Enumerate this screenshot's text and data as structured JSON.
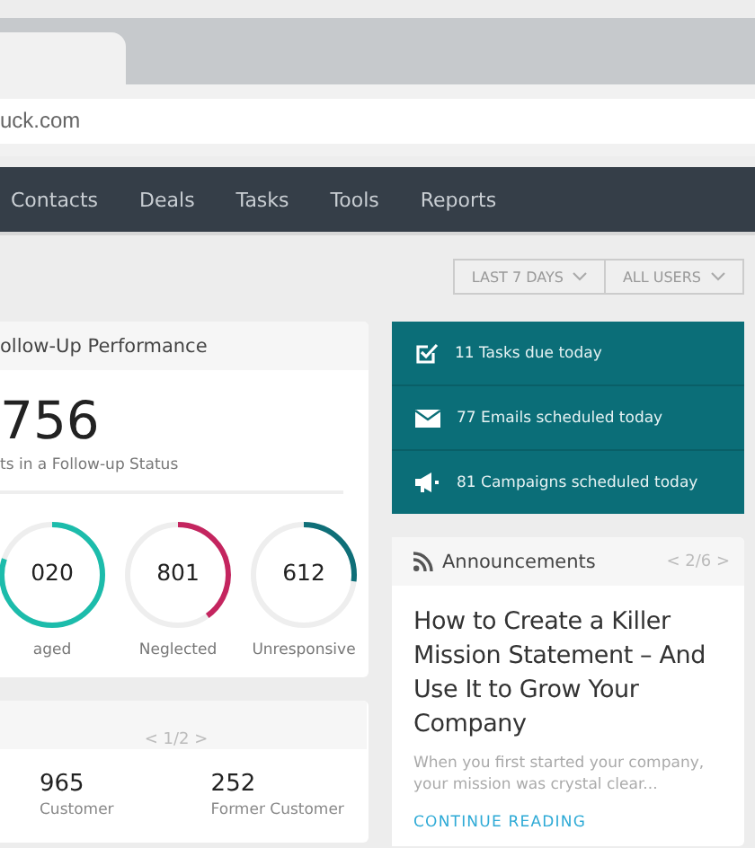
{
  "browser": {
    "address": "uck.com"
  },
  "nav": [
    {
      "label": "Contacts",
      "selected": false
    },
    {
      "label": "Deals",
      "selected": false
    },
    {
      "label": "Tasks",
      "selected": false
    },
    {
      "label": "Tools",
      "selected": false
    },
    {
      "label": "Reports",
      "selected": false
    }
  ],
  "filters": [
    {
      "label": "LAST 7 DAYS"
    },
    {
      "label": "ALL USERS"
    }
  ],
  "follow_up": {
    "title": "ollow-Up Performance",
    "total": "756",
    "subtitle": "ts in a Follow-up Status",
    "rings": [
      {
        "value": "020",
        "label": "aged",
        "level": 0.8,
        "color": "#1cbcab"
      },
      {
        "value": "801",
        "label": "Neglected",
        "level": 0.4,
        "color": "#c4255f"
      },
      {
        "value": "612",
        "label": "Unresponsive",
        "level": 0.27,
        "color": "#0f6f78"
      }
    ]
  },
  "today": [
    {
      "kind": "tasks",
      "text": "11 Tasks due today"
    },
    {
      "kind": "emails",
      "text": "77 Emails scheduled today"
    },
    {
      "kind": "campaigns",
      "text": "81 Campaigns scheduled today"
    }
  ],
  "announcements": {
    "title": "Announcements",
    "pager": "< 2/6 >",
    "headline": "How to Create a Killer Mission Statement – And Use It to Grow Your Company",
    "excerpt": "When you first started your company, your mission was crystal clear...",
    "link": "CONTINUE READING"
  },
  "contacts_card": {
    "pager": "< 1/2 >",
    "stats": [
      {
        "value": "965",
        "label": "Customer"
      },
      {
        "value": "252",
        "label": "Former Customer"
      }
    ]
  }
}
